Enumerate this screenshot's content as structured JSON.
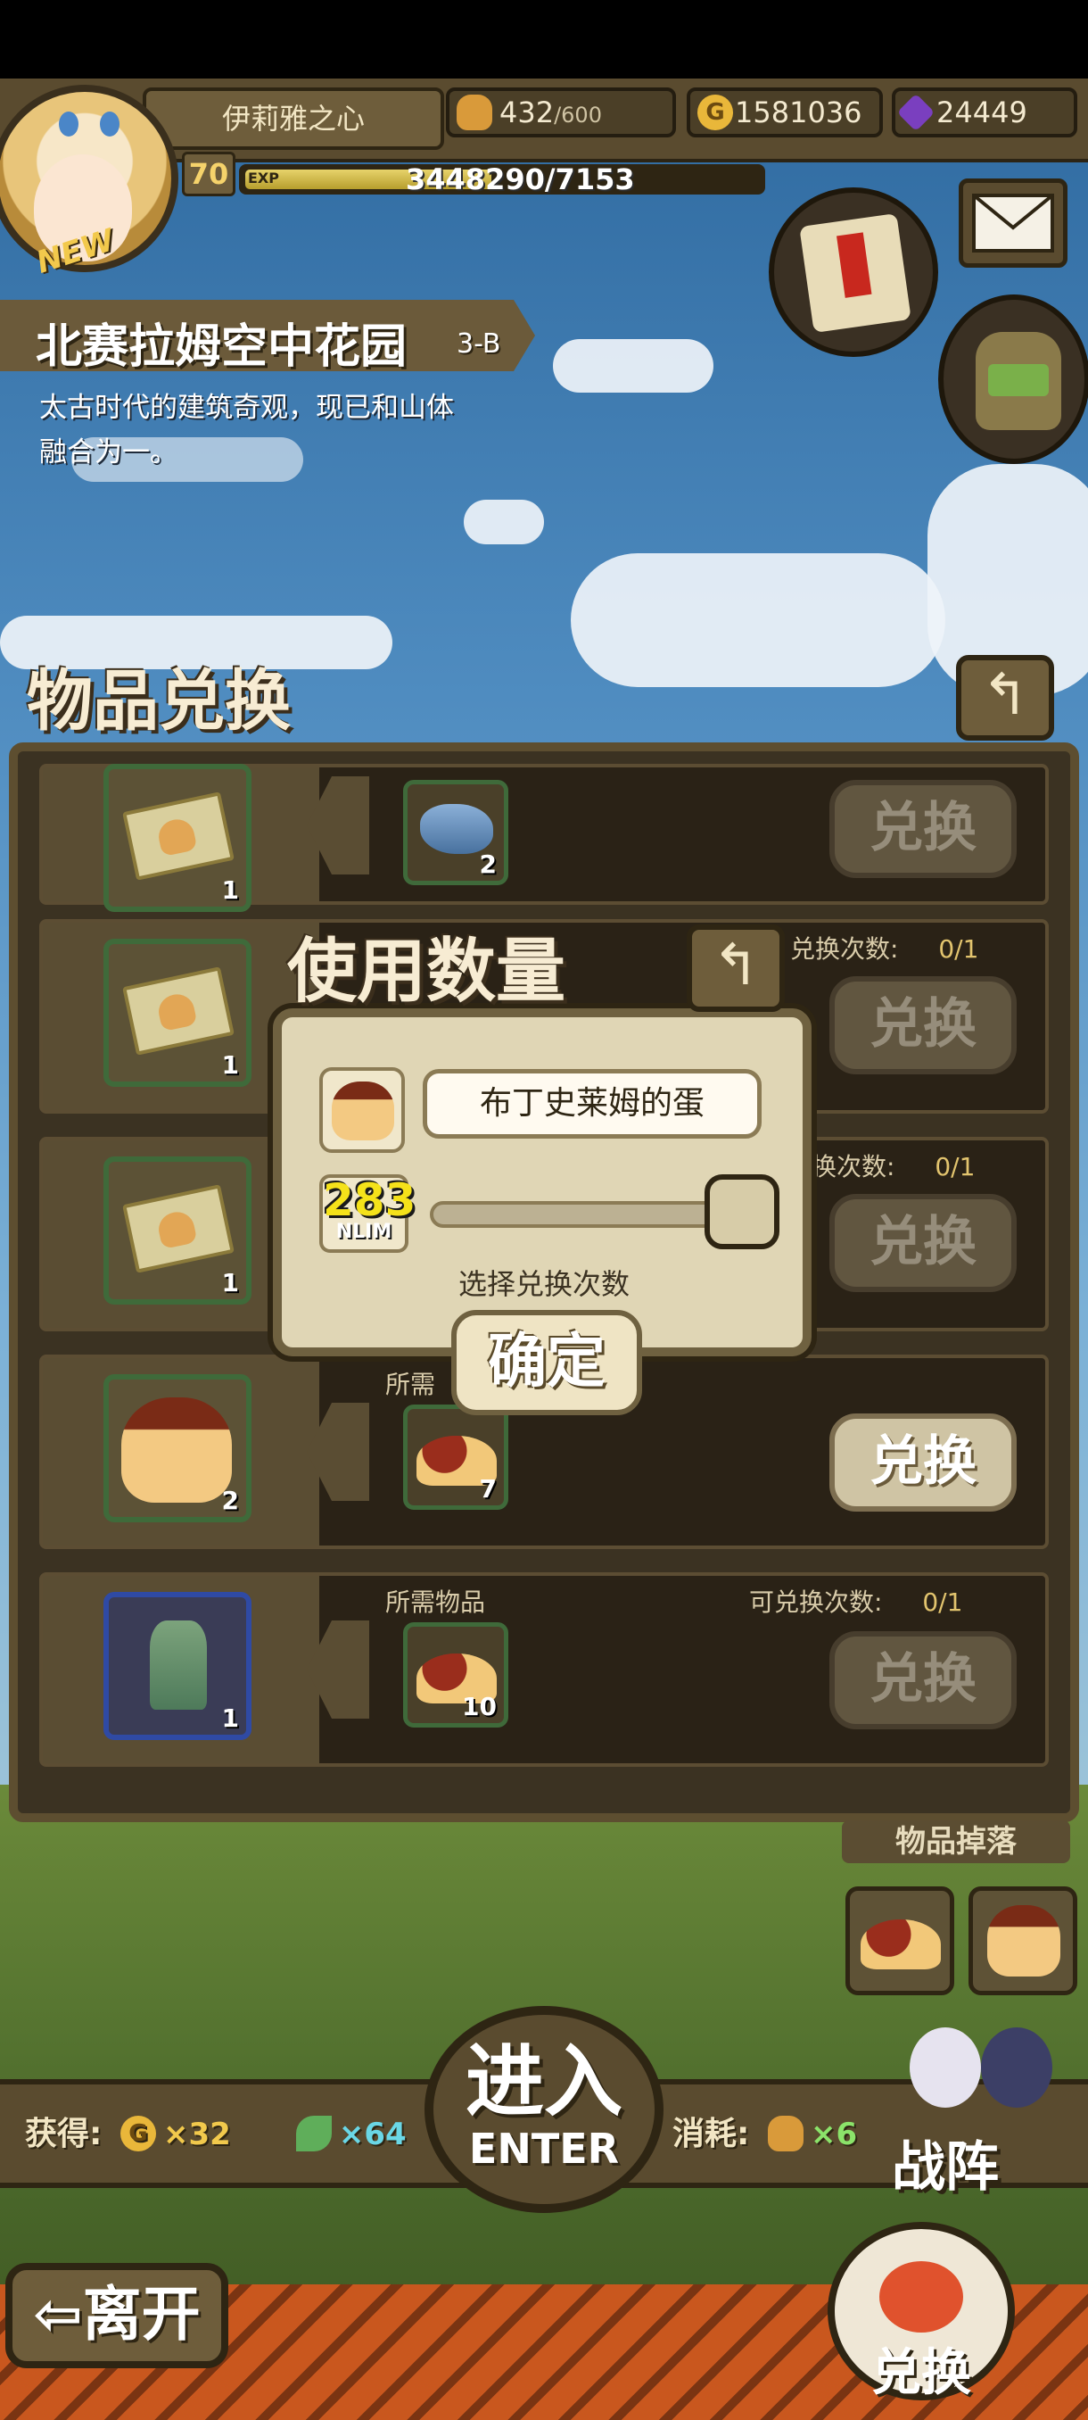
{
  "header": {
    "player_name": "伊莉雅之心",
    "new_badge": "NEW",
    "level": "70",
    "exp_tag": "EXP",
    "exp_text": "3448290/7153",
    "exp_progress": 0.48,
    "stamina": "432",
    "stamina_max": "/600",
    "gold_symbol": "G",
    "gold": "1581036",
    "gems": "24449"
  },
  "location": {
    "title": "北赛拉姆空中花园",
    "stage": "3-B",
    "description_line1": "太古时代的建筑奇观，现已和山体",
    "description_line2": "融合为一。"
  },
  "panel": {
    "title": "物品兑换",
    "back_icon": "↰",
    "rows": [
      {
        "item_count": "1",
        "req_count": "2",
        "button": "兑换",
        "header_label": "",
        "header_count_label": "",
        "header_count": ""
      },
      {
        "item_count": "1",
        "req_count": "",
        "button": "兑换",
        "header_label": "",
        "header_count_label": "兑换次数:",
        "header_count": "0/1"
      },
      {
        "item_count": "1",
        "req_count": "",
        "button": "兑换",
        "header_label": "",
        "header_count_label": "换次数:",
        "header_count": "0/1"
      },
      {
        "item_count": "2",
        "req_count": "7",
        "button": "兑换",
        "header_label": "所需",
        "header_count_label": "",
        "header_count": ""
      },
      {
        "item_count": "1",
        "req_count": "10",
        "button": "兑换",
        "header_label": "所需物品",
        "header_count_label": "可兑换次数:",
        "header_count": "0/1"
      }
    ]
  },
  "dialog": {
    "title": "使用数量",
    "back_icon": "↰",
    "item_name": "布丁史莱姆的蛋",
    "quantity": "283",
    "quantity_sub": "NLIM",
    "slider_fraction": 1.0,
    "hint": "选择兑换次数",
    "confirm": "确定"
  },
  "bottom": {
    "drop_label": "物品掉落",
    "gain_label": "获得:",
    "gain_gold": "×32",
    "gain_feather": "×64",
    "cost_label": "消耗:",
    "cost_bread": "×6",
    "enter_cn": "进入",
    "enter_en": "ENTER",
    "formation": "战阵",
    "leave": "⇦离开",
    "exchange": "兑换"
  },
  "colors": {
    "gold": "#e9b73a",
    "gem": "#7a3fbf",
    "feather_text": "#6ad7e6",
    "gain_text": "#f2c94c",
    "cost_text": "#8be36a",
    "exp_text": "#ffffff"
  }
}
